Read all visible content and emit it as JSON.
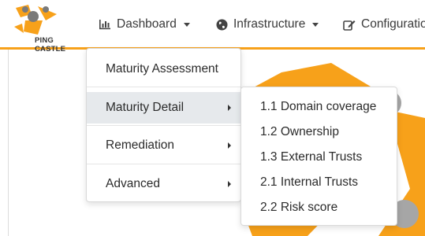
{
  "brand": {
    "logo_text": "PING CASTLE"
  },
  "navbar": {
    "dashboard": {
      "label": "Dashboard",
      "icon": "bar-chart-icon"
    },
    "infrastructure": {
      "label": "Infrastructure",
      "icon": "globe-icon"
    },
    "configuration": {
      "label": "Configuratio",
      "icon": "edit-icon"
    }
  },
  "colors": {
    "accent": "#f7a11a",
    "gray_node": "#a6a6a6",
    "menu_active": "#e6e9ec"
  },
  "main_menu": {
    "items": [
      {
        "label": "Maturity Assessment",
        "has_submenu": false
      },
      {
        "label": "Maturity Detail",
        "has_submenu": true,
        "active": true
      },
      {
        "label": "Remediation",
        "has_submenu": true
      },
      {
        "label": "Advanced",
        "has_submenu": true
      }
    ]
  },
  "sub_menu": {
    "items": [
      {
        "label": "1.1 Domain coverage"
      },
      {
        "label": "1.2 Ownership"
      },
      {
        "label": "1.3 External Trusts"
      },
      {
        "label": "2.1 Internal Trusts"
      },
      {
        "label": "2.2 Risk score"
      }
    ]
  }
}
